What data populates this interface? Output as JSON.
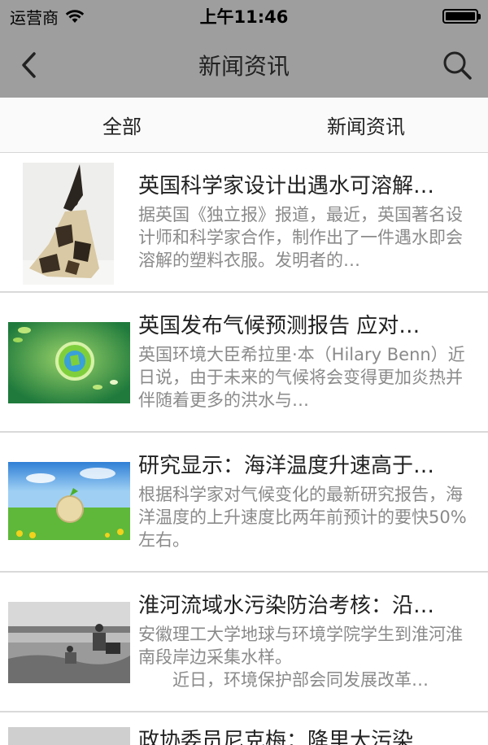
{
  "status": {
    "carrier": "运营商",
    "time": "上午11:46"
  },
  "nav": {
    "title": "新闻资讯"
  },
  "tabs": [
    {
      "label": "全部"
    },
    {
      "label": "新闻资讯"
    }
  ],
  "articles": [
    {
      "title": "英国科学家设计出遇水可溶解…",
      "summary": "据英国《独立报》报道，最近，英国著名设计师和科学家合作，制作出了一件遇水即会溶解的塑料衣服。发明者的…"
    },
    {
      "title": "英国发布气候预测报告 应对…",
      "summary": "英国环境大臣希拉里·本（Hilary Benn）近日说，由于未来的气候将会变得更加炎热并伴随着更多的洪水与…"
    },
    {
      "title": "研究显示：海洋温度升速高于…",
      "summary": "根据科学家对气候变化的最新研究报告，海洋温度的上升速度比两年前预计的要快50%左右。"
    },
    {
      "title": "淮河流域水污染防治考核：沿…",
      "summary": "安徽理工大学地球与环境学院学生到淮河淮南段岸边采集水样。\n　　近日，环境保护部会同发展改革…"
    },
    {
      "title": "政协委员尼克梅：降里大污染",
      "summary": ""
    }
  ]
}
